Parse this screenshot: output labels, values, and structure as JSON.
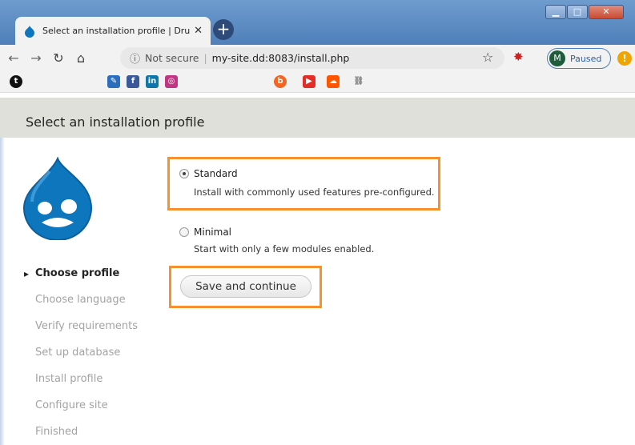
{
  "browser": {
    "tab_title": "Select an installation profile | Dru",
    "not_secure_label": "Not secure",
    "url": "my-site.dd:8083/install.php",
    "profile_initial": "M",
    "profile_status": "Paused",
    "alert_glyph": "!"
  },
  "page": {
    "title": "Select an installation profile"
  },
  "profiles": [
    {
      "label": "Standard",
      "description": "Install with commonly used features pre-configured.",
      "selected": true
    },
    {
      "label": "Minimal",
      "description": "Start with only a few modules enabled.",
      "selected": false
    }
  ],
  "actions": {
    "save_label": "Save and continue"
  },
  "steps": [
    "Choose profile",
    "Choose language",
    "Verify requirements",
    "Set up database",
    "Install profile",
    "Configure site",
    "Finished"
  ],
  "colors": {
    "highlight": "#f7902d",
    "drupal_blue": "#0e76bd",
    "header_band": "#dfe0d9"
  }
}
